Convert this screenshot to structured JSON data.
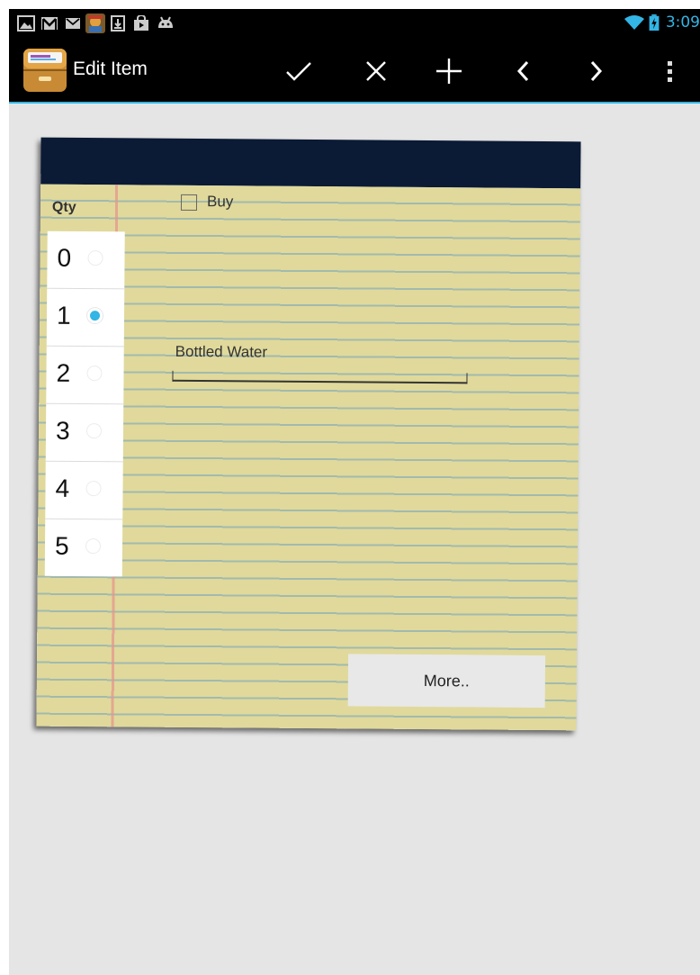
{
  "status_bar": {
    "time": "3:09",
    "accent_color": "#33b5e5",
    "notification_icons": [
      "gallery-icon",
      "gmail-icon",
      "email-icon",
      "app-notification-icon",
      "download-icon",
      "play-store-icon",
      "android-debug-icon"
    ],
    "system_icons": [
      "wifi-icon",
      "battery-icon"
    ]
  },
  "action_bar": {
    "title": "Edit Item",
    "app_icon": "drawer-app-icon",
    "actions": [
      "check-icon",
      "close-icon",
      "add-icon",
      "previous-icon",
      "next-icon",
      "overflow-menu-icon"
    ]
  },
  "notepad": {
    "qty_label": "Qty",
    "quantities": [
      "0",
      "1",
      "2",
      "3",
      "4",
      "5"
    ],
    "selected_quantity": "1",
    "buy_label": "Buy",
    "buy_checked": false,
    "item_name": "Bottled Water",
    "more_button_label": "More.."
  }
}
